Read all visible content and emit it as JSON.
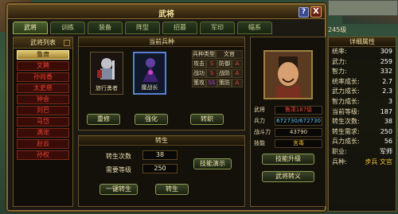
{
  "window": {
    "title": "武将",
    "help_label": "?",
    "close_label": "X"
  },
  "tabs": [
    "武将",
    "训练",
    "装备",
    "阵型",
    "招募",
    "军印",
    "幅系"
  ],
  "general_list": {
    "header": "武将列表",
    "items": [
      "鲁肃",
      "文聘",
      "孙尚香",
      "太史慈",
      "钟会",
      "刘巴",
      "马岱",
      "满宠",
      "赵云",
      "孙权"
    ],
    "selected_index": 0
  },
  "troop": {
    "header": "当前兵种",
    "unit_left": "旅行勇者",
    "unit_right": "魔战长",
    "stats": {
      "type_label": "兵种类型",
      "type_value": "文官",
      "rows": [
        {
          "k1": "攻击",
          "g1": "S",
          "k2": "防御",
          "g2": "A"
        },
        {
          "k1": "战功",
          "g1": "S",
          "k2": "战防",
          "g2": "A"
        },
        {
          "k1": "策攻",
          "g1": "SS",
          "k2": "策防",
          "g2": "A"
        }
      ]
    },
    "btn_repair": "重修",
    "btn_enhance": "强化",
    "btn_unlock": "转职"
  },
  "rebirth": {
    "header": "转生",
    "count_label": "转生次数",
    "count_value": "38",
    "level_label": "需要等级",
    "level_value": "250",
    "btn_demo": "技能演示",
    "btn_oneclick": "一键转生",
    "btn_rebirth": "转生"
  },
  "info": {
    "name_label": "武将",
    "name_value": "鲁肃187级",
    "troops_label": "兵力",
    "troops_value": "672730/672730",
    "power_label": "战斗力",
    "power_value": "43790",
    "skill_label": "技能",
    "skill_value": "言毒",
    "btn_skill_up": "技能升级",
    "btn_inherit": "武将转义"
  },
  "top_level": "245级",
  "attributes": {
    "header": "详细属性",
    "rows": [
      {
        "k": "统率:",
        "v": "309"
      },
      {
        "k": "武力:",
        "v": "259"
      },
      {
        "k": "智力:",
        "v": "332"
      },
      {
        "k": "统率成长:",
        "v": "2.7"
      },
      {
        "k": "武力成长:",
        "v": "2.3"
      },
      {
        "k": "智力成长:",
        "v": "3"
      },
      {
        "k": "当前等级:",
        "v": "187"
      },
      {
        "k": "转生次数:",
        "v": "38"
      },
      {
        "k": "转生需求:",
        "v": "250"
      },
      {
        "k": "兵力成长:",
        "v": "56"
      },
      {
        "k": "职业:",
        "v": "军师"
      },
      {
        "k": "兵种:",
        "v": "步兵 文官"
      }
    ]
  },
  "colors": {
    "accent": "#8a6a30",
    "selected_gen": "#e0c870",
    "enemy_red": "#e84030",
    "grade_S": "#e84030",
    "grade_SS": "#b040e0",
    "grade_A": "#e84030",
    "skill_name": "#f0c030"
  }
}
